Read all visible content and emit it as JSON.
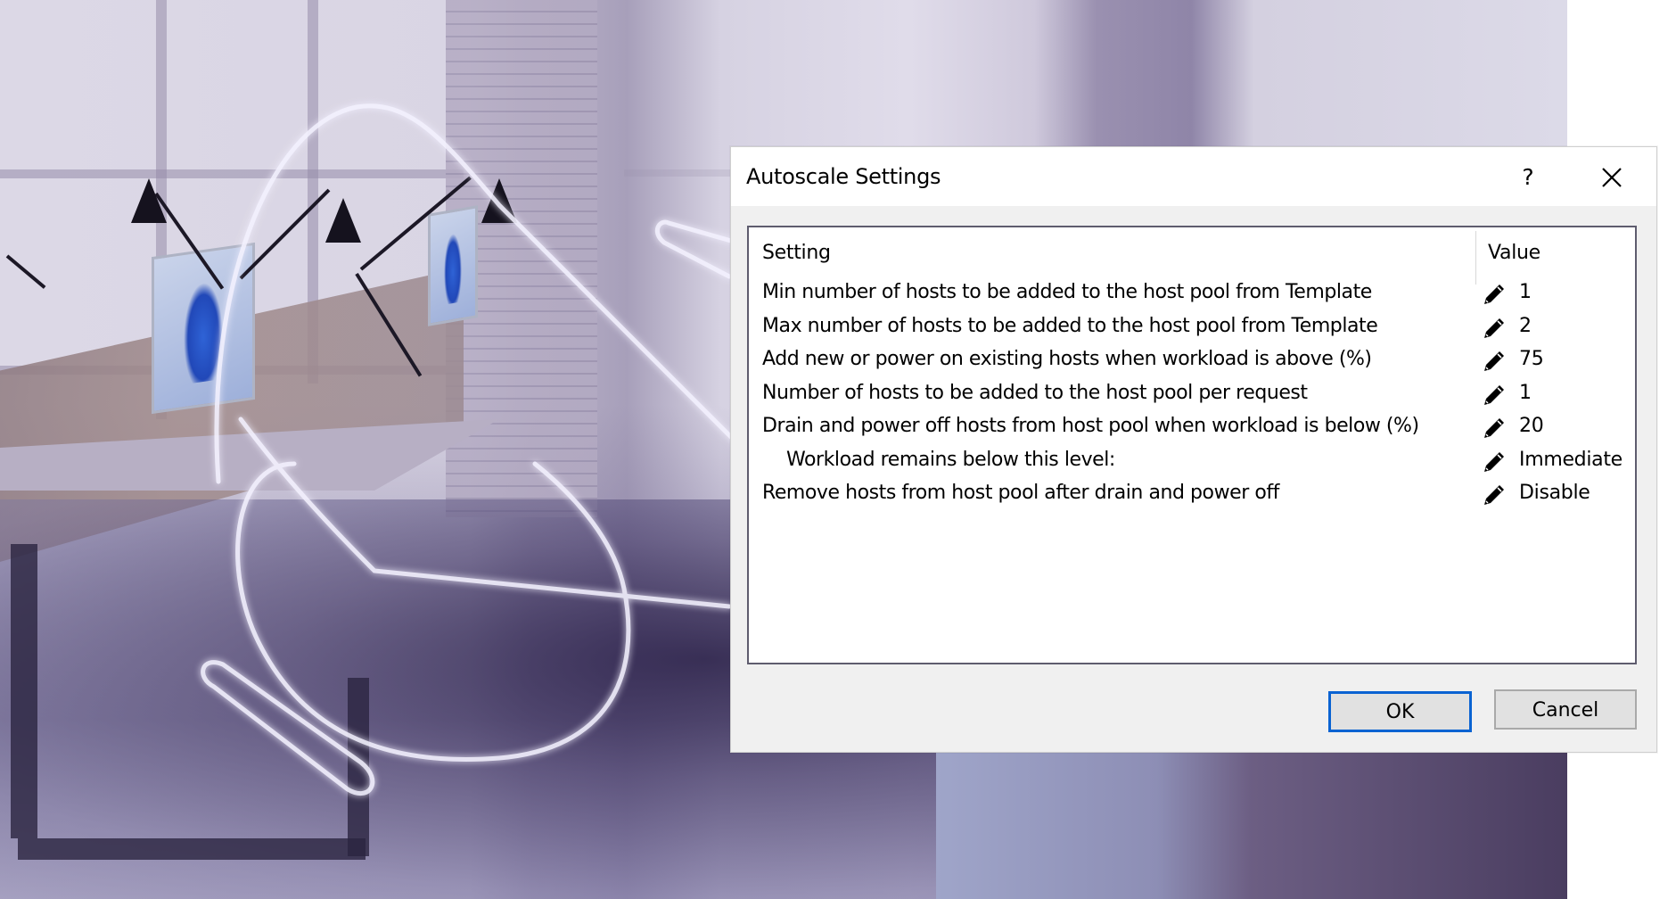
{
  "background": {
    "description": "office workspace photo with desks, monitors, lamps and neon glow outline",
    "neon_color": "#f4f2ff"
  },
  "dialog": {
    "title": "Autoscale Settings",
    "help_label": "?",
    "close_icon": "close-icon",
    "table": {
      "columns": [
        "Setting",
        "Value"
      ],
      "rows": [
        {
          "setting": "Min number of hosts to be added to the host pool from Template",
          "value": "1",
          "icon": "pencil-icon",
          "indent": false
        },
        {
          "setting": "Max number of hosts to be added to the host pool from Template",
          "value": "2",
          "icon": "pencil-icon",
          "indent": false
        },
        {
          "setting": "Add new or power on existing hosts when workload is above (%)",
          "value": "75",
          "icon": "pencil-icon",
          "indent": false
        },
        {
          "setting": "Number of hosts to be added to the host pool per request",
          "value": "1",
          "icon": "pencil-icon",
          "indent": false
        },
        {
          "setting": "Drain and power off hosts from host pool when workload is below (%)",
          "value": "20",
          "icon": "pencil-icon",
          "indent": false
        },
        {
          "setting": "Workload remains below this level:",
          "value": "Immediate",
          "icon": "pencil-icon",
          "indent": true
        },
        {
          "setting": "Remove hosts from host pool after drain and power off",
          "value": "Disable",
          "icon": "pencil-icon",
          "indent": false
        }
      ]
    },
    "buttons": {
      "ok_label": "OK",
      "cancel_label": "Cancel"
    },
    "colors": {
      "focus_border": "#0a63d2",
      "dialog_bg": "#f0f0f0",
      "titlebar_bg": "#ffffff"
    }
  }
}
